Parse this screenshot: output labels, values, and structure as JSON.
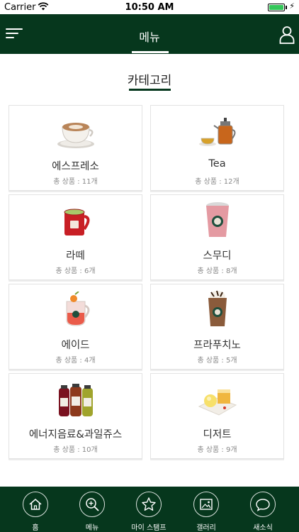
{
  "status_bar": {
    "carrier": "Carrier",
    "time": "10:50 AM",
    "battery_level": 0.9
  },
  "header": {
    "title": "메뉴",
    "background": "#06371d"
  },
  "section": {
    "title": "카테고리"
  },
  "categories": [
    {
      "name": "에스프레소",
      "count": "총 상품 : 11개",
      "icon": "espresso-cup-icon"
    },
    {
      "name": "Tea",
      "count": "총 상품 : 12개",
      "icon": "teapot-icon"
    },
    {
      "name": "라떼",
      "count": "총 상품 : 6개",
      "icon": "latte-mug-icon"
    },
    {
      "name": "스무디",
      "count": "총 상품 : 8개",
      "icon": "smoothie-cup-icon"
    },
    {
      "name": "에이드",
      "count": "총 상품 : 4개",
      "icon": "ade-pitcher-icon"
    },
    {
      "name": "프라푸치노",
      "count": "총 상품 : 5개",
      "icon": "frappuccino-cup-icon"
    },
    {
      "name": "에너지음료&과일쥬스",
      "count": "총 상품 : 10개",
      "icon": "juice-bottles-icon"
    },
    {
      "name": "디저트",
      "count": "총 상품 : 9개",
      "icon": "dessert-plate-icon"
    }
  ],
  "tabbar": {
    "items": [
      {
        "label": "홈",
        "icon": "home-icon"
      },
      {
        "label": "메뉴",
        "icon": "search-icon"
      },
      {
        "label": "마이 스탬프",
        "icon": "star-icon"
      },
      {
        "label": "갤러리",
        "icon": "gallery-icon"
      },
      {
        "label": "새소식",
        "icon": "chat-bubble-icon"
      }
    ]
  }
}
